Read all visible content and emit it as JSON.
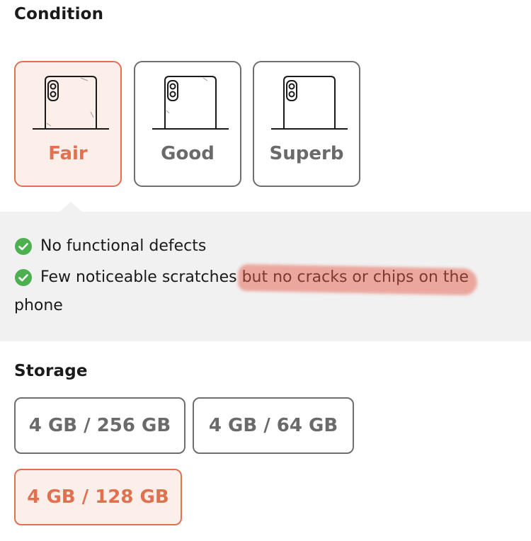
{
  "condition": {
    "title": "Condition",
    "options": [
      {
        "label": "Fair",
        "selected": true
      },
      {
        "label": "Good",
        "selected": false
      },
      {
        "label": "Superb",
        "selected": false
      }
    ]
  },
  "features": {
    "items": [
      {
        "text": "No functional defects"
      },
      {
        "text": "Few noticeable scratches",
        "highlighted": "but no cracks or chips on the",
        "wrap": "phone"
      }
    ],
    "check_color": "#4caf50",
    "highlight_color": "#e98a7e"
  },
  "storage": {
    "title": "Storage",
    "options": [
      {
        "label": "4 GB / 256 GB",
        "selected": false
      },
      {
        "label": "4 GB / 64 GB",
        "selected": false
      },
      {
        "label": "4 GB / 128 GB",
        "selected": true
      }
    ]
  },
  "colors": {
    "accent": "#e07050",
    "accent_bg": "#fcefea",
    "border": "#6e6e6e",
    "panel_bg": "#f1f1f1"
  }
}
